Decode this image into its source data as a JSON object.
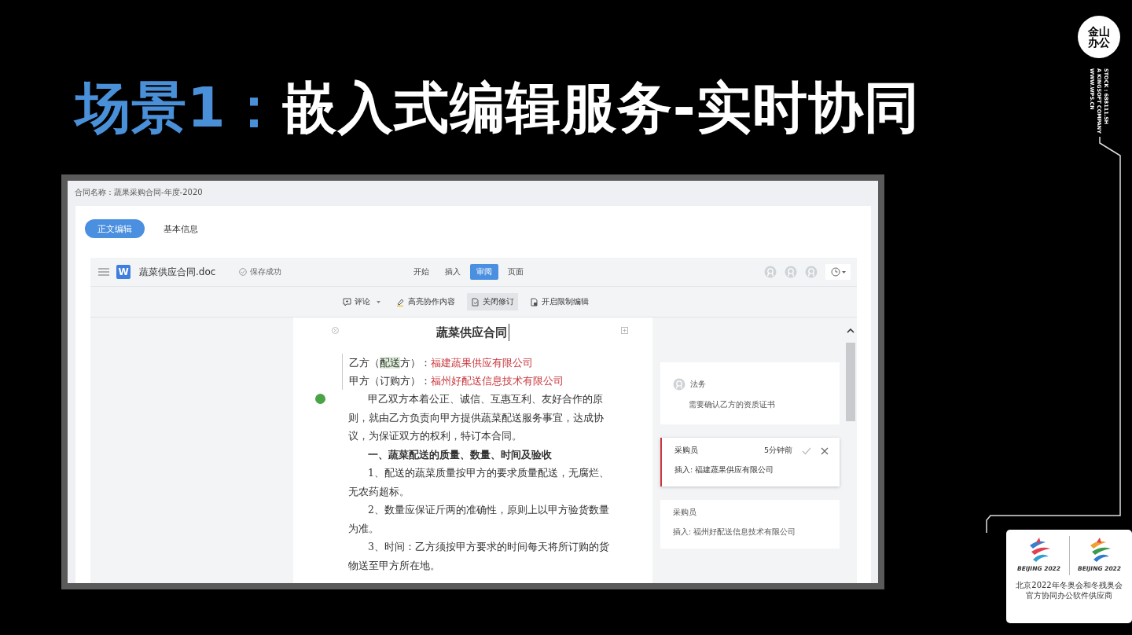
{
  "slide": {
    "title_prefix": "场景1：",
    "title": "嵌入式编辑服务-实时协同"
  },
  "brand": {
    "logo": [
      "金山",
      "办公"
    ],
    "lines": [
      "STOCK : 688111.SH",
      "A KINGSOFT COMPANY",
      "WWW.WPS.CN"
    ]
  },
  "sponsor": {
    "emblem_labels": [
      "BEIJING 2022",
      "BEIJING 2022"
    ],
    "caption": [
      "北京2022年冬奥会和冬残奥会",
      "官方协同办公软件供应商"
    ]
  },
  "app": {
    "contract_name": "合同名称：蔬果采购合同-年度-2020",
    "tabs": [
      {
        "label": "正文编辑",
        "selected": true
      },
      {
        "label": "基本信息",
        "selected": false
      }
    ],
    "editor": {
      "file_icon": "W",
      "file_name": "蔬菜供应合同.doc",
      "save_status": "保存成功",
      "menu": [
        {
          "label": "开始",
          "selected": false
        },
        {
          "label": "插入",
          "selected": false
        },
        {
          "label": "审阅",
          "selected": true
        },
        {
          "label": "页面",
          "selected": false
        }
      ],
      "toolbar": [
        {
          "kind": "comment",
          "label": "评论",
          "on": false
        },
        {
          "kind": "highlight",
          "label": "高亮协作内容",
          "on": false
        },
        {
          "kind": "revision",
          "label": "关闭修订",
          "on": true
        },
        {
          "kind": "restrict",
          "label": "开启限制编辑",
          "on": false
        }
      ],
      "document": {
        "title": "蔬菜供应合同",
        "parties": [
          [
            {
              "kind": "plain",
              "text": "乙方（"
            },
            {
              "kind": "highlight",
              "text": "配送"
            },
            {
              "kind": "plain",
              "text": "方）："
            },
            {
              "kind": "insert",
              "text": "福建蔬果供应有限公司"
            }
          ],
          [
            {
              "kind": "plain",
              "text": "甲方（订购方）："
            },
            {
              "kind": "insert",
              "text": "福州好配送信息技术有限公司"
            }
          ]
        ],
        "paragraphs": [
          {
            "kind": "body",
            "text": "甲乙双方本着公正、诚信、互惠互利、友好合作的原则，就由乙方负责向甲方提供蔬菜配送服务事宜，达成协议，为保证双方的权利，特订本合同。",
            "comment": true
          },
          {
            "kind": "heading",
            "text": "一、蔬菜配送的质量、数量、时间及验收",
            "comment": false
          },
          {
            "kind": "body",
            "text": "1、配送的蔬菜质量按甲方的要求质量配送，无腐烂、无农药超标。",
            "comment": false
          },
          {
            "kind": "body",
            "text": "2、数量应保证斤两的准确性，原则上以甲方验货数量为准。",
            "comment": false
          },
          {
            "kind": "body",
            "text": "3、时间：乙方须按甲方要求的时间每天将所订购的货物送至甲方所在地。",
            "comment": false
          }
        ]
      },
      "comments": [
        {
          "kind": "comment",
          "author": "法务",
          "text": "需要确认乙方的资质证书",
          "selected": false
        },
        {
          "kind": "revision",
          "author": "采购员",
          "time": "5分钟前",
          "text": "插入: 福建蔬果供应有限公司",
          "selected": true
        },
        {
          "kind": "revision",
          "author": "采购员",
          "text": "插入: 福州好配送信息技术有限公司",
          "selected": false
        }
      ]
    }
  }
}
